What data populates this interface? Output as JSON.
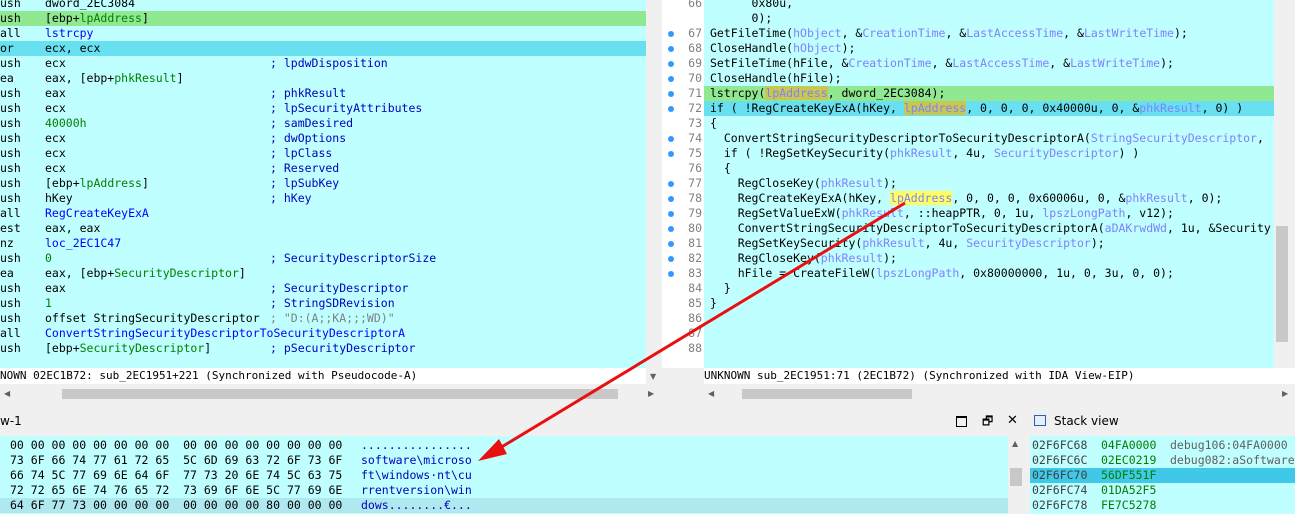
{
  "ida_view": {
    "lines": [
      {
        "mnem": "ush",
        "ops": "dword_2EC3084",
        "cmt": ""
      },
      {
        "mnem": "ush",
        "ops": "[ebp+lpAddress]",
        "cmt": "",
        "hl": "green"
      },
      {
        "mnem": "all",
        "ops": "lstrcpy",
        "cmt": ""
      },
      {
        "mnem": "or",
        "ops": "ecx, ecx",
        "cmt": "",
        "hl": "cyan"
      },
      {
        "mnem": "ush",
        "ops": "ecx",
        "cmt": "; lpdwDisposition"
      },
      {
        "mnem": "ea",
        "ops": "eax, [ebp+phkResult]",
        "cmt": ""
      },
      {
        "mnem": "ush",
        "ops": "eax",
        "cmt": "; phkResult"
      },
      {
        "mnem": "ush",
        "ops": "ecx",
        "cmt": "; lpSecurityAttributes"
      },
      {
        "mnem": "ush",
        "ops": "40000h",
        "cmt": "; samDesired"
      },
      {
        "mnem": "ush",
        "ops": "ecx",
        "cmt": "; dwOptions"
      },
      {
        "mnem": "ush",
        "ops": "ecx",
        "cmt": "; lpClass"
      },
      {
        "mnem": "ush",
        "ops": "ecx",
        "cmt": "; Reserved"
      },
      {
        "mnem": "ush",
        "ops": "[ebp+lpAddress]",
        "cmt": "; lpSubKey"
      },
      {
        "mnem": "ush",
        "ops": "hKey",
        "cmt": "; hKey"
      },
      {
        "mnem": "all",
        "ops": "RegCreateKeyExA",
        "cmt": ""
      },
      {
        "mnem": "est",
        "ops": "eax, eax",
        "cmt": ""
      },
      {
        "mnem": "nz",
        "ops": "loc_2EC1C47",
        "cmt": ""
      },
      {
        "mnem": "ush",
        "ops": "0",
        "cmt": "; SecurityDescriptorSize"
      },
      {
        "mnem": "ea",
        "ops": "eax, [ebp+SecurityDescriptor]",
        "cmt": ""
      },
      {
        "mnem": "ush",
        "ops": "eax",
        "cmt": "; SecurityDescriptor"
      },
      {
        "mnem": "ush",
        "ops": "1",
        "cmt": "; StringSDRevision"
      },
      {
        "mnem": "ush",
        "ops": "offset StringSecurityDescriptor",
        "cmt": "; \"D:(A;;KA;;;WD)\""
      },
      {
        "mnem": "all",
        "ops": "ConvertStringSecurityDescriptorToSecurityDescriptorA",
        "cmt": ""
      },
      {
        "mnem": "ush",
        "ops": "[ebp+SecurityDescriptor]",
        "cmt": "; pSecurityDescriptor"
      }
    ],
    "status": "NOWN 02EC1B72: sub_2EC1951+221 (Synchronized with Pseudocode-A)"
  },
  "pseudocode": {
    "lines": [
      {
        "num": "66",
        "code": "      0x80u,",
        "dot": false
      },
      {
        "num": "",
        "code": "      0);",
        "dot": false
      },
      {
        "num": "67",
        "code": "GetFileTime(hObject, &CreationTime, &LastAccessTime, &LastWriteTime);",
        "dot": true
      },
      {
        "num": "68",
        "code": "CloseHandle(hObject);",
        "dot": true
      },
      {
        "num": "69",
        "code": "SetFileTime(hFile, &CreationTime, &LastAccessTime, &LastWriteTime);",
        "dot": true
      },
      {
        "num": "70",
        "code": "CloseHandle(hFile);",
        "dot": true
      },
      {
        "num": "71",
        "code": "lstrcpy(lpAddress, dword_2EC3084);",
        "dot": true,
        "hl": "green"
      },
      {
        "num": "72",
        "code": "if ( !RegCreateKeyExA(hKey, lpAddress, 0, 0, 0, 0x40000u, 0, &phkResult, 0) )",
        "dot": true,
        "hl": "cyan"
      },
      {
        "num": "73",
        "code": "{",
        "dot": false
      },
      {
        "num": "74",
        "code": "  ConvertStringSecurityDescriptorToSecurityDescriptorA(StringSecurityDescriptor,",
        "dot": true
      },
      {
        "num": "75",
        "code": "  if ( !RegSetKeySecurity(phkResult, 4u, SecurityDescriptor) )",
        "dot": true
      },
      {
        "num": "76",
        "code": "  {",
        "dot": false
      },
      {
        "num": "77",
        "code": "    RegCloseKey(phkResult);",
        "dot": true
      },
      {
        "num": "78",
        "code": "    RegCreateKeyExA(hKey, lpAddress, 0, 0, 0, 0x60006u, 0, &phkResult, 0);",
        "dot": true
      },
      {
        "num": "79",
        "code": "    RegSetValueExW(phkResult, ::heapPTR, 0, 1u, lpszLongPath, v12);",
        "dot": true
      },
      {
        "num": "80",
        "code": "    ConvertStringSecurityDescriptorToSecurityDescriptorA(aDAKrwdWd, 1u, &Security",
        "dot": true
      },
      {
        "num": "81",
        "code": "    RegSetKeySecurity(phkResult, 4u, SecurityDescriptor);",
        "dot": true
      },
      {
        "num": "82",
        "code": "    RegCloseKey(phkResult);",
        "dot": true
      },
      {
        "num": "83",
        "code": "    hFile = CreateFileW(lpszLongPath, 0x80000000, 1u, 0, 3u, 0, 0);",
        "dot": true
      },
      {
        "num": "84",
        "code": "  }",
        "dot": false
      },
      {
        "num": "85",
        "code": "}",
        "dot": false
      },
      {
        "num": "86",
        "code": "",
        "dot": false
      },
      {
        "num": "87",
        "code": "",
        "dot": false
      },
      {
        "num": "88",
        "code": "",
        "dot": false
      }
    ],
    "status": "UNKNOWN sub_2EC1951:71 (2EC1B72) (Synchronized with IDA View-EIP)"
  },
  "hex_view": {
    "tab_title": "w-1",
    "lines": [
      {
        "bytes": "00 00 00 00 00 00 00 00  00 00 00 00 00 00 00 00",
        "ascii": "................"
      },
      {
        "bytes": "73 6F 66 74 77 61 72 65  5C 6D 69 63 72 6F 73 6F",
        "ascii": "software\\microso"
      },
      {
        "bytes": "66 74 5C 77 69 6E 64 6F  77 73 20 6E 74 5C 63 75",
        "ascii": "ft\\windows·nt\\cu"
      },
      {
        "bytes": "72 72 65 6E 74 76 65 72  73 69 6F 6E 5C 77 69 6E",
        "ascii": "rrentversion\\win"
      },
      {
        "bytes": "64 6F 77 73 00 00 00 00  00 00 00 00 80 00 00 00",
        "ascii": "dows........€..."
      }
    ]
  },
  "stack_view": {
    "title": "Stack view",
    "rows": [
      {
        "addr": "02F6FC68",
        "val": "04FA0000",
        "label": "debug106:04FA0000"
      },
      {
        "addr": "02F6FC6C",
        "val": "02EC0219",
        "label": "debug082:aSoftware"
      },
      {
        "addr": "02F6FC70",
        "val": "56DF551F",
        "label": "",
        "hl": true
      },
      {
        "addr": "02F6FC74",
        "val": "01DA52F5",
        "label": ""
      },
      {
        "addr": "02F6FC78",
        "val": "FE7C5278",
        "label": ""
      }
    ]
  },
  "colors": {
    "accent_arrow": "#e81010",
    "pane_bg": "#c0ffff"
  }
}
